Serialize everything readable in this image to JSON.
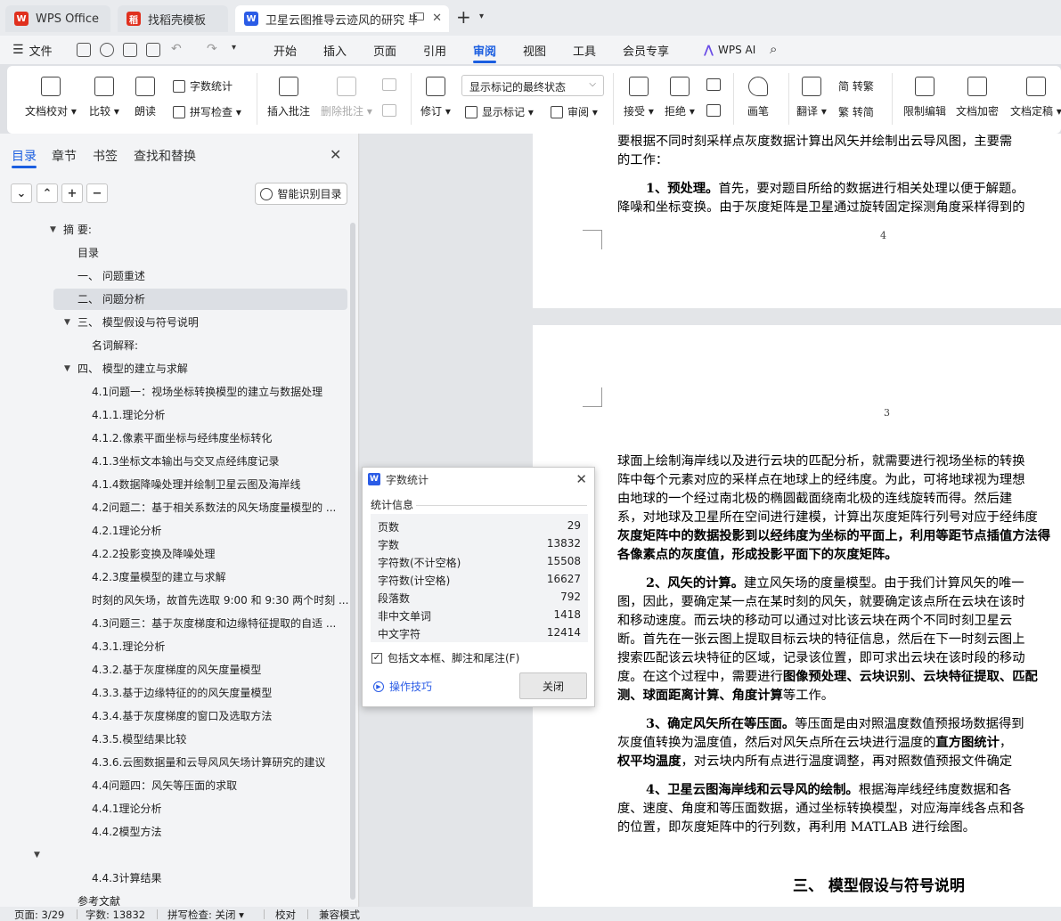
{
  "tabs": [
    {
      "label": "WPS Office",
      "icon": "wps-logo-icon",
      "color": "#e0301e"
    },
    {
      "label": "找稻壳模板",
      "icon": "docer-logo-icon",
      "color": "#e0301e"
    },
    {
      "label": "卫星云图推导云迹风的研究 毕",
      "icon": "wps-writer-icon",
      "color": "#2b5ce6"
    }
  ],
  "menubar": {
    "file": "文件",
    "items": [
      "开始",
      "插入",
      "页面",
      "引用",
      "审阅",
      "视图",
      "工具",
      "会员专享"
    ],
    "active": "审阅",
    "wps_ai": "WPS AI",
    "accent": "#1b5ee0"
  },
  "ribbon": {
    "doc_check": "文档校对",
    "compare": "比较",
    "read_aloud": "朗读",
    "word_count": "字数统计",
    "spell_check": "拼写检查",
    "insert_comment": "插入批注",
    "delete_comment": "删除批注",
    "revise": "修订",
    "show_mode": "显示标记的最终状态",
    "show_marks": "显示标记",
    "review": "审阅",
    "accept": "接受",
    "reject": "拒绝",
    "pen": "画笔",
    "translate": "翻译",
    "to_traditional": "简 转繁",
    "to_simplified": "繁 转简",
    "restrict_edit": "限制编辑",
    "encrypt": "文档加密",
    "finalize": "文档定稿"
  },
  "nav": {
    "tabs": [
      "目录",
      "章节",
      "书签",
      "查找和替换"
    ],
    "active_tab": "目录",
    "smart_toc": "智能识别目录",
    "toc": [
      {
        "text": "摘 要:",
        "level": 0,
        "caret": "down"
      },
      {
        "text": "目录",
        "level": 1
      },
      {
        "text": "一、 问题重述",
        "level": 1
      },
      {
        "text": "二、 问题分析",
        "level": 1,
        "selected": true
      },
      {
        "text": "三、 模型假设与符号说明",
        "level": 1,
        "caret": "down"
      },
      {
        "text": "名词解释:",
        "level": 2
      },
      {
        "text": "四、 模型的建立与求解",
        "level": 1,
        "caret": "down"
      },
      {
        "text": "4.1问题一：视场坐标转换模型的建立与数据处理",
        "level": 2
      },
      {
        "text": "4.1.1.理论分析",
        "level": 2
      },
      {
        "text": "4.1.2.像素平面坐标与经纬度坐标转化",
        "level": 2
      },
      {
        "text": "4.1.3坐标文本输出与交叉点经纬度记录",
        "level": 2
      },
      {
        "text": "4.1.4数据降噪处理并绘制卫星云图及海岸线",
        "level": 2
      },
      {
        "text": "4.2问题二：基于相关系数法的风矢场度量模型的 ...",
        "level": 2
      },
      {
        "text": "4.2.1理论分析",
        "level": 2
      },
      {
        "text": "4.2.2投影变换及降噪处理",
        "level": 2
      },
      {
        "text": "4.2.3度量模型的建立与求解",
        "level": 2
      },
      {
        "text": "时刻的风矢场，故首先选取 9:00 和 9:30 两个时刻 ...",
        "level": 2
      },
      {
        "text": "4.3问题三：基于灰度梯度和边缘特征提取的自适 ...",
        "level": 2
      },
      {
        "text": "4.3.1.理论分析",
        "level": 2
      },
      {
        "text": "4.3.2.基于灰度梯度的风矢度量模型",
        "level": 2
      },
      {
        "text": "4.3.3.基于边缘特征的的风矢度量模型",
        "level": 2
      },
      {
        "text": "4.3.4.基于灰度梯度的窗口及选取方法",
        "level": 2
      },
      {
        "text": "4.3.5.模型结果比较",
        "level": 2
      },
      {
        "text": "4.3.6.云图数据量和云导风风矢场计算研究的建议",
        "level": 2
      },
      {
        "text": "4.4问题四：风矢等压面的求取",
        "level": 2
      },
      {
        "text": "4.4.1理论分析",
        "level": 2
      },
      {
        "text": "4.4.2模型方法",
        "level": 2
      },
      {
        "text": "",
        "level": 0,
        "caret": "down"
      },
      {
        "text": "4.4.3计算结果",
        "level": 2
      },
      {
        "text": "参考文献",
        "level": 1
      }
    ]
  },
  "doc": {
    "page1": {
      "lines": [
        "要根据不同时刻采样点灰度数据计算出风矢并绘制出云导风图，主要需",
        "的工作："
      ],
      "item1_head": "1、预处理。",
      "item1_rest": "首先，要对题目所给的数据进行相关处理以便于解题。",
      "item1_line2": "降噪和坐标变换。由于灰度矩阵是卫星通过旋转固定探测角度采样得到的",
      "page_number": "4"
    },
    "page2": {
      "page_number": "3",
      "p1": [
        "球面上绘制海岸线以及进行云块的匹配分析，就需要进行视场坐标的转换",
        "阵中每个元素对应的采样点在地球上的经纬度。为此，可将地球视为理想",
        "由地球的一个经过南北极的椭圆截面绕南北极的连线旋转而得。然后建",
        "系，对地球及卫星所在空间进行建模，计算出灰度矩阵行列号对应于经纬度"
      ],
      "p1_bold": [
        "灰度矩阵中的数据投影到以经纬度为坐标的平面上，利用等距节点插值方法得",
        "各像素点的灰度值，形成投影平面下的灰度矩阵。"
      ],
      "item2_head": "2、风矢的计算。",
      "item2_rest": "建立风矢场的度量模型。由于我们计算风矢的唯一",
      "item2_lines": [
        "图，因此，要确定某一点在某时刻的风矢，就要确定该点所在云块在该时",
        "和移动速度。而云块的移动可以通过对比该云块在两个不同时刻卫星云",
        "断。首先在一张云图上提取目标云块的特征信息，然后在下一时刻云图上",
        "搜索匹配该云块特征的区域，记录该位置，即可求出云块在该时段的移动"
      ],
      "item2_last_a": "度。在这个过程中，需要进行",
      "item2_last_b": "图像预处理、云块识别、云块特征提取、匹配",
      "item2_end_a": "测、球面距离计算、角度计算",
      "item2_end_b": "等工作。",
      "item3_head": "3、确定风矢所在等压面。",
      "item3_rest": "等压面是由对照温度数值预报场数据得到",
      "item3_line2a": "灰度值转换为温度值，然后对风矢点所在云块进行温度的",
      "item3_line2b": "直方图统计",
      "item3_line2c": "，",
      "item3_line3a": "权平均温度",
      "item3_line3b": "，对云块内所有点进行温度调整，再对照数值预报文件确定",
      "item4_head": "4、卫星云图海岸线和云导风的绘制。",
      "item4_rest": "根据海岸线经纬度数据和各",
      "item4_line2": "度、速度、角度和等压面数据，通过坐标转换模型，对应海岸线各点和各",
      "item4_line3": "的位置，即灰度矩阵中的行列数，再利用 MATLAB 进行绘图。",
      "section_heading": "三、  模型假设与符号说明"
    }
  },
  "dialog": {
    "title": "字数统计",
    "section": "统计信息",
    "stats": [
      {
        "label": "页数",
        "value": "29"
      },
      {
        "label": "字数",
        "value": "13832"
      },
      {
        "label": "字符数(不计空格)",
        "value": "15508"
      },
      {
        "label": "字符数(计空格)",
        "value": "16627"
      },
      {
        "label": "段落数",
        "value": "792"
      },
      {
        "label": "非中文单词",
        "value": "1418"
      },
      {
        "label": "中文字符",
        "value": "12414"
      }
    ],
    "include_label": "包括文本框、脚注和尾注(F)",
    "include_checked": "✓",
    "tips": "操作技巧",
    "close": "关闭"
  },
  "statusbar": {
    "page": "页面: 3/29",
    "words": "字数: 13832",
    "spell": "拼写检查: 关闭",
    "proof": "校对",
    "compat": "兼容模式"
  }
}
